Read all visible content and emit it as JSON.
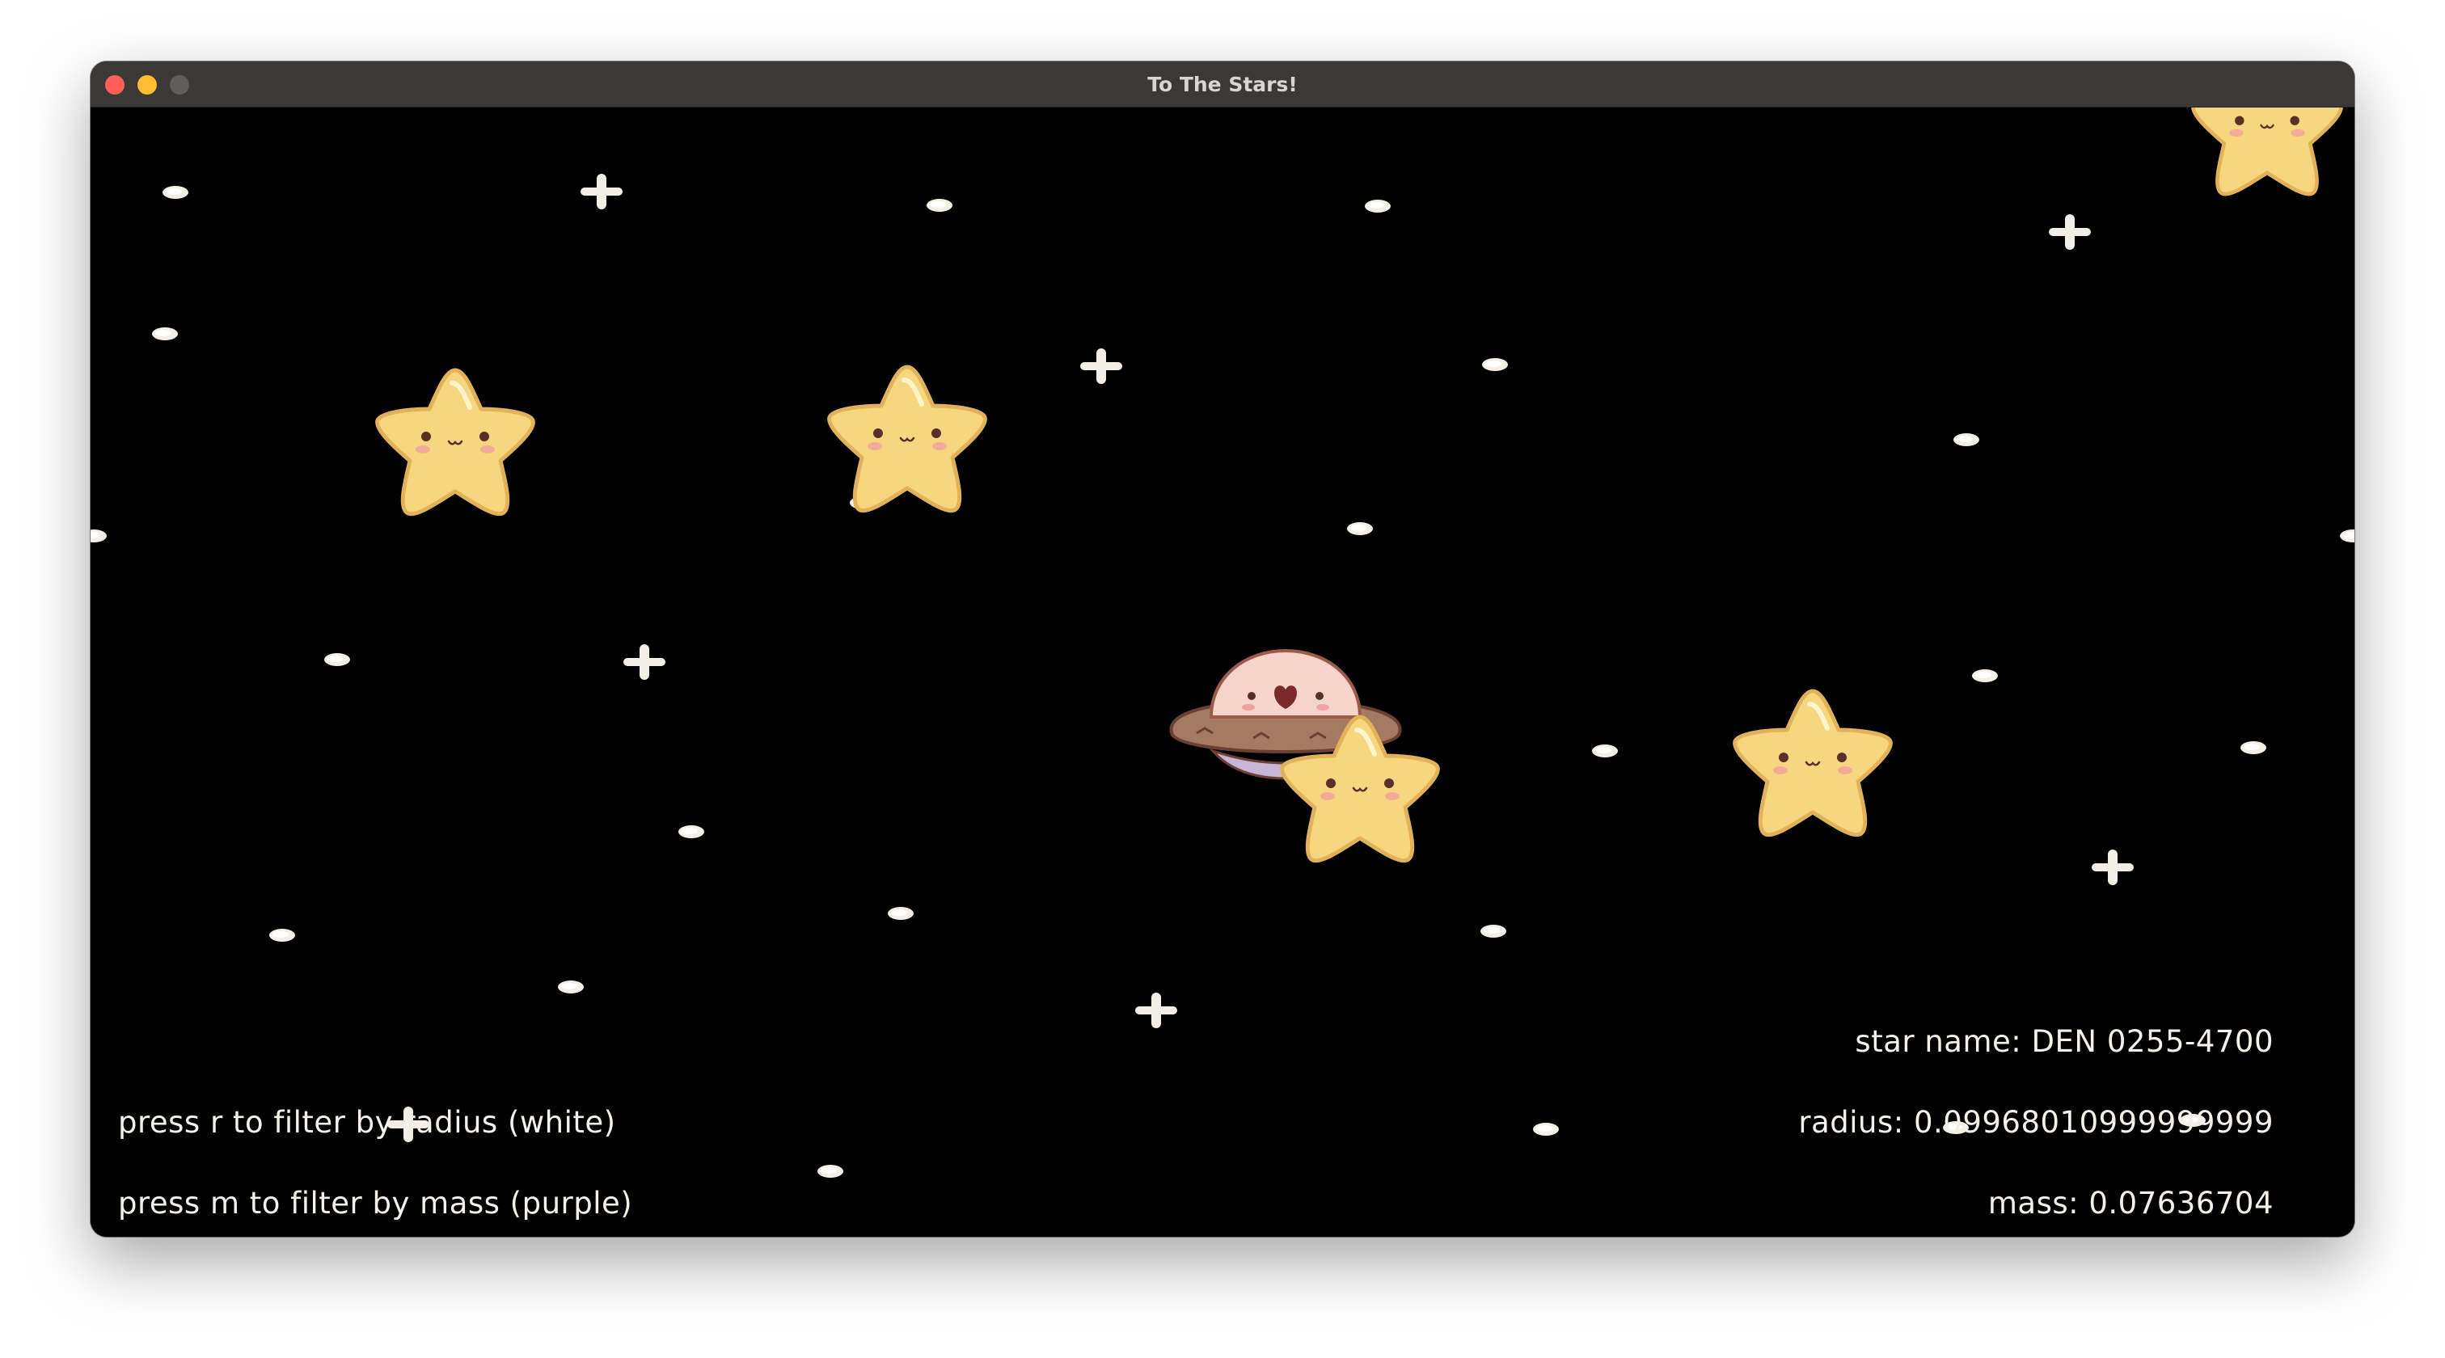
{
  "window": {
    "title": "To The Stars!"
  },
  "hud": {
    "instructions": [
      "press r to filter by radius (white)",
      "press m to filter by mass (purple)"
    ],
    "star_info": {
      "name": "star name: DEN 0255-4700",
      "radius": "radius: 0.09968010999999999",
      "mass": "mass: 0.07636704"
    }
  },
  "colors": {
    "background": "#000000",
    "star_fill": "#f6d77f",
    "star_outline": "#e6b85f",
    "sparkle": "#f4efe6",
    "ufo_dome": "#f7d4c9",
    "ufo_ring": "#a57a63",
    "ufo_base": "#c9b6d6"
  },
  "sprites": {
    "star": "cute-star-icon",
    "ufo": "ufo-ship-icon",
    "sparkle": "sparkle-icon"
  }
}
